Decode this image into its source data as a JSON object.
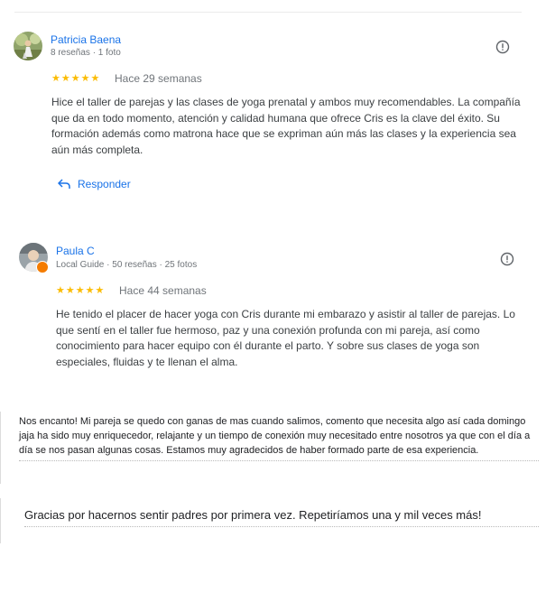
{
  "reviews": [
    {
      "author": "Patricia Baena",
      "meta": "8 reseñas · 1 foto",
      "stars": "★★★★★",
      "rating": 5,
      "date": "Hace 29 semanas",
      "text": "Hice el taller de parejas y las clases de yoga prenatal y ambos muy recomendables. La compañía que da en todo momento, atención y calidad humana que ofrece Cris es la clave del éxito. Su formación además como matrona hace que se expriman aún más las clases y la experiencia sea aún más completa.",
      "reply_label": "Responder",
      "report_icon": "report-icon",
      "avatar_icon": "avatar-photo"
    },
    {
      "author": "Paula C",
      "meta": "Local Guide · 50 reseñas · 25 fotos",
      "stars": "★★★★★",
      "rating": 5,
      "date": "Hace 44 semanas",
      "text": "He tenido el placer de hacer yoga con Cris durante mi embarazo y asistir al taller de parejas. Lo que sentí en el taller fue hermoso, paz y una conexión profunda con mi pareja, así como conocimiento para hacer equipo con él durante el parto. Y sobre sus clases de yoga son especiales, fluidas y te llenan el alma.",
      "report_icon": "report-icon",
      "avatar_icon": "avatar-photo",
      "badge_icon": "local-guide-badge-icon"
    }
  ],
  "quotes": [
    {
      "text": "Nos encanto! Mi pareja se quedo con ganas de mas cuando salimos, comento que necesita algo así cada domingo jaja ha sido muy enriquecedor, relajante y un tiempo de conexión muy necesitado entre nosotros ya que con el día a día se nos pasan algunas cosas. Estamos muy agradecidos de haber formado parte de esa experiencia."
    },
    {
      "text": "Gracias por hacernos sentir padres por primera vez. Repetiríamos una y mil veces más!"
    }
  ],
  "colors": {
    "link": "#1a73e8",
    "star": "#fbbc04",
    "meta": "#70757a",
    "text": "#3c4043",
    "badge": "#f57c00"
  }
}
